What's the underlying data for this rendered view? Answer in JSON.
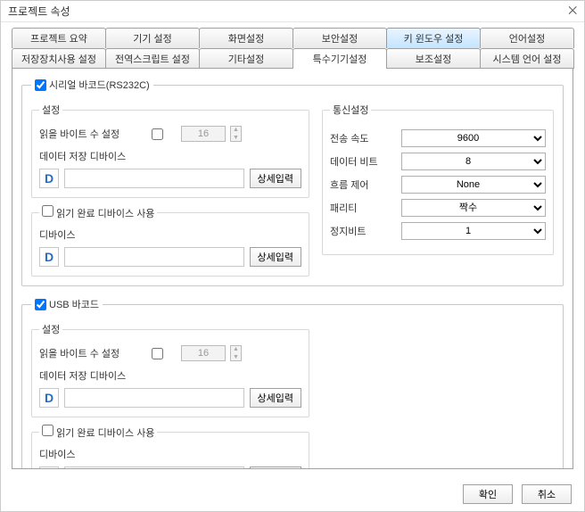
{
  "window_title": "프로젝트 속성",
  "close_glyph": "⨉",
  "tabs_row1": [
    "프로젝트 요약",
    "기기 설정",
    "화면설정",
    "보안설정",
    "키 윈도우 설정",
    "언어설정"
  ],
  "tabs_row2": [
    "저장장치사용 설정",
    "전역스크립트 설정",
    "기타설정",
    "특수기기설정",
    "보조설정",
    "시스템 언어 설정"
  ],
  "serial": {
    "title": "시리얼 바코드(RS232C)",
    "settings_title": "설정",
    "byte_label": "읽을 바이트 수 설정",
    "byte_value": "16",
    "storage_label": "데이터 저장 디바이스",
    "indicator": "D",
    "detail_btn": "상세입력",
    "read_done_title": "읽기 완료 디바이스 사용",
    "device_label": "디바이스"
  },
  "comm": {
    "title": "통신설정",
    "baud_label": "전송 속도",
    "baud_value": "9600",
    "databit_label": "데이터 비트",
    "databit_value": "8",
    "flow_label": "흐름 제어",
    "flow_value": "None",
    "parity_label": "패리티",
    "parity_value": "짝수",
    "stopbit_label": "정지비트",
    "stopbit_value": "1"
  },
  "usb": {
    "title": "USB 바코드",
    "settings_title": "설정",
    "byte_label": "읽을 바이트 수 설정",
    "byte_value": "16",
    "storage_label": "데이터 저장 디바이스",
    "indicator": "D",
    "detail_btn": "상세입력",
    "read_done_title": "읽기 완료 디바이스 사용",
    "device_label": "디바이스"
  },
  "ok_label": "확인",
  "cancel_label": "취소"
}
